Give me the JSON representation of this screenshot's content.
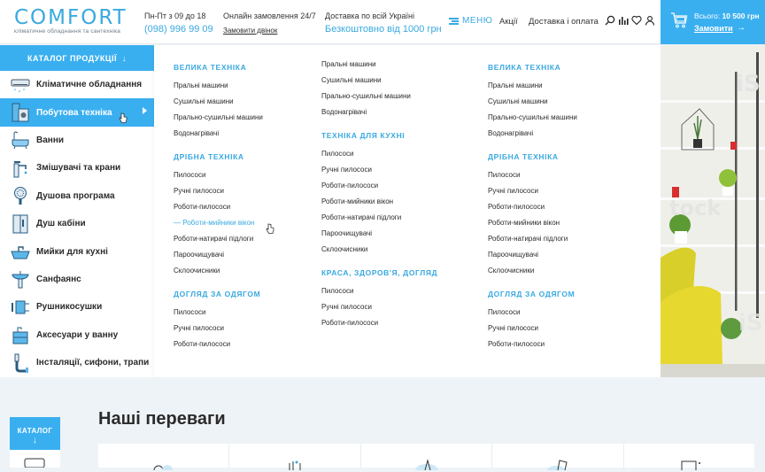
{
  "header": {
    "logo": {
      "name": "COMFORT",
      "tagline": "кліматичне обладнання та сантехніка"
    },
    "hours": {
      "label": "Пн-Пт з 09 до 18",
      "phone": "(098) 996 99 09"
    },
    "online": {
      "label": "Онлайн замовлення 24/7",
      "link": "Замовити двінок"
    },
    "delivery": {
      "label": "Доставка по всій Україні",
      "value": "Безкоштовно від 1000 грн"
    },
    "menu_label": "МЕНЮ",
    "nav": [
      "Акції",
      "Доставка і оплата"
    ],
    "icons": [
      "search-icon",
      "compare-icon",
      "heart-icon",
      "user-icon"
    ],
    "cart": {
      "total_label": "Всього:",
      "total_value": "10 500 грн",
      "order_link": "Замовити",
      "arrow": "→"
    }
  },
  "catalog": {
    "title": "КАТАЛОГ ПРОДУКЦІЇ",
    "arrow": "↓",
    "items": [
      {
        "label": "Кліматичне обладнання",
        "icon": "air-conditioner-icon",
        "active": false
      },
      {
        "label": "Побутова техніка",
        "icon": "washing-machine-icon",
        "active": true
      },
      {
        "label": "Ванни",
        "icon": "bathtub-icon",
        "active": false
      },
      {
        "label": "Змішувачі та крани",
        "icon": "faucet-icon",
        "active": false
      },
      {
        "label": "Душова програма",
        "icon": "shower-head-icon",
        "active": false
      },
      {
        "label": "Душ кабіни",
        "icon": "shower-cabin-icon",
        "active": false
      },
      {
        "label": "Мийки для кухні",
        "icon": "kitchen-sink-icon",
        "active": false
      },
      {
        "label": "Санфаянс",
        "icon": "washbasin-icon",
        "active": false
      },
      {
        "label": "Рушникосушки",
        "icon": "towel-dryer-icon",
        "active": false
      },
      {
        "label": "Аксесуари у ванну",
        "icon": "bathroom-cabinet-icon",
        "active": false
      },
      {
        "label": "Інсталяції, сифони, трапи",
        "icon": "siphon-icon",
        "active": false
      }
    ]
  },
  "mega_menu": {
    "columns": [
      {
        "sections": [
          {
            "title": "ВЕЛИКА ТЕХНІКА",
            "links": [
              "Пральні машини",
              "Сушильні машини",
              "Прально-сушильні машини",
              "Водонагрівачі"
            ]
          },
          {
            "title": "ДРІБНА ТЕХНІКА",
            "links": [
              "Пилососи",
              "Ручні пилососи",
              "Роботи-пилососи",
              "— Роботи-мийники вікон",
              "Роботи-натирачі підлоги",
              "Пароочищувачі",
              "Склоочисники"
            ]
          },
          {
            "title": "ДОГЛЯД ЗА ОДЯГОМ",
            "links": [
              "Пилососи",
              "Ручні пилососи",
              "Роботи-пилососи"
            ]
          }
        ]
      },
      {
        "sections": [
          {
            "title": "",
            "links": [
              "Пральні машини",
              "Сушильні машини",
              "Прально-сушильні машини",
              "Водонагрівачі"
            ]
          },
          {
            "title": "ТЕХНІКА ДЛЯ КУХНІ",
            "links": [
              "Пилососи",
              "Ручні пилососи",
              "Роботи-пилососи",
              "Роботи-мийники вікон",
              "Роботи-натирачі підлоги",
              "Пароочищувачі",
              "Склоочисники"
            ]
          },
          {
            "title": "КРАСА, ЗДОРОВ'Я, ДОГЛЯД",
            "links": [
              "Пилососи",
              "Ручні пилососи",
              "Роботи-пилососи"
            ]
          }
        ]
      },
      {
        "sections": [
          {
            "title": "ВЕЛИКА ТЕХНІКА",
            "links": [
              "Пральні машини",
              "Сушильні машини",
              "Прально-сушильні машини",
              "Водонагрівачі"
            ]
          },
          {
            "title": "ДРІБНА ТЕХНІКА",
            "links": [
              "Пилососи",
              "Ручні пилососи",
              "Роботи-пилососи",
              "Роботи-мийники вікон",
              "Роботи-натирачі підлоги",
              "Пароочищувачі",
              "Склоочисники"
            ]
          },
          {
            "title": "ДОГЛЯД ЗА ОДЯГОМ",
            "links": [
              "Пилососи",
              "Ручні пилососи",
              "Роботи-пилососи"
            ]
          }
        ]
      }
    ],
    "hovered_link": "— Роботи-мийники вікон"
  },
  "advantages": {
    "title": "Наші переваги",
    "side_catalog": {
      "label": "КАТАЛОГ",
      "arrow": "↓"
    }
  },
  "colors": {
    "accent": "#3aaff0",
    "link": "#3aa9e0",
    "text": "#2b2b2b",
    "bg": "#eef3f7"
  }
}
